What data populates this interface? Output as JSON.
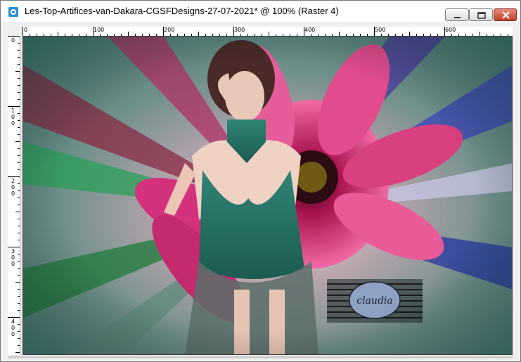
{
  "window": {
    "title": "Les-Top-Artifices-van-Dakara-CGSFDesigns-27-07-2021* @ 100% (Raster 4)",
    "app_icon": "psp-icon",
    "controls": {
      "minimize": "minimize-icon",
      "maximize": "maximize-icon",
      "close": "close-icon"
    },
    "close_color": "#c3412e"
  },
  "ruler_h": {
    "labels": [
      "0",
      "100",
      "200",
      "300",
      "400",
      "500",
      "600"
    ]
  },
  "ruler_v": {
    "labels": [
      "0",
      "100",
      "200",
      "300",
      "400"
    ]
  },
  "canvas": {
    "background": "#3f7b74",
    "watermark_text": "claudia",
    "accent_pink": "#d4327c",
    "accent_teal": "#2e7a6e"
  }
}
